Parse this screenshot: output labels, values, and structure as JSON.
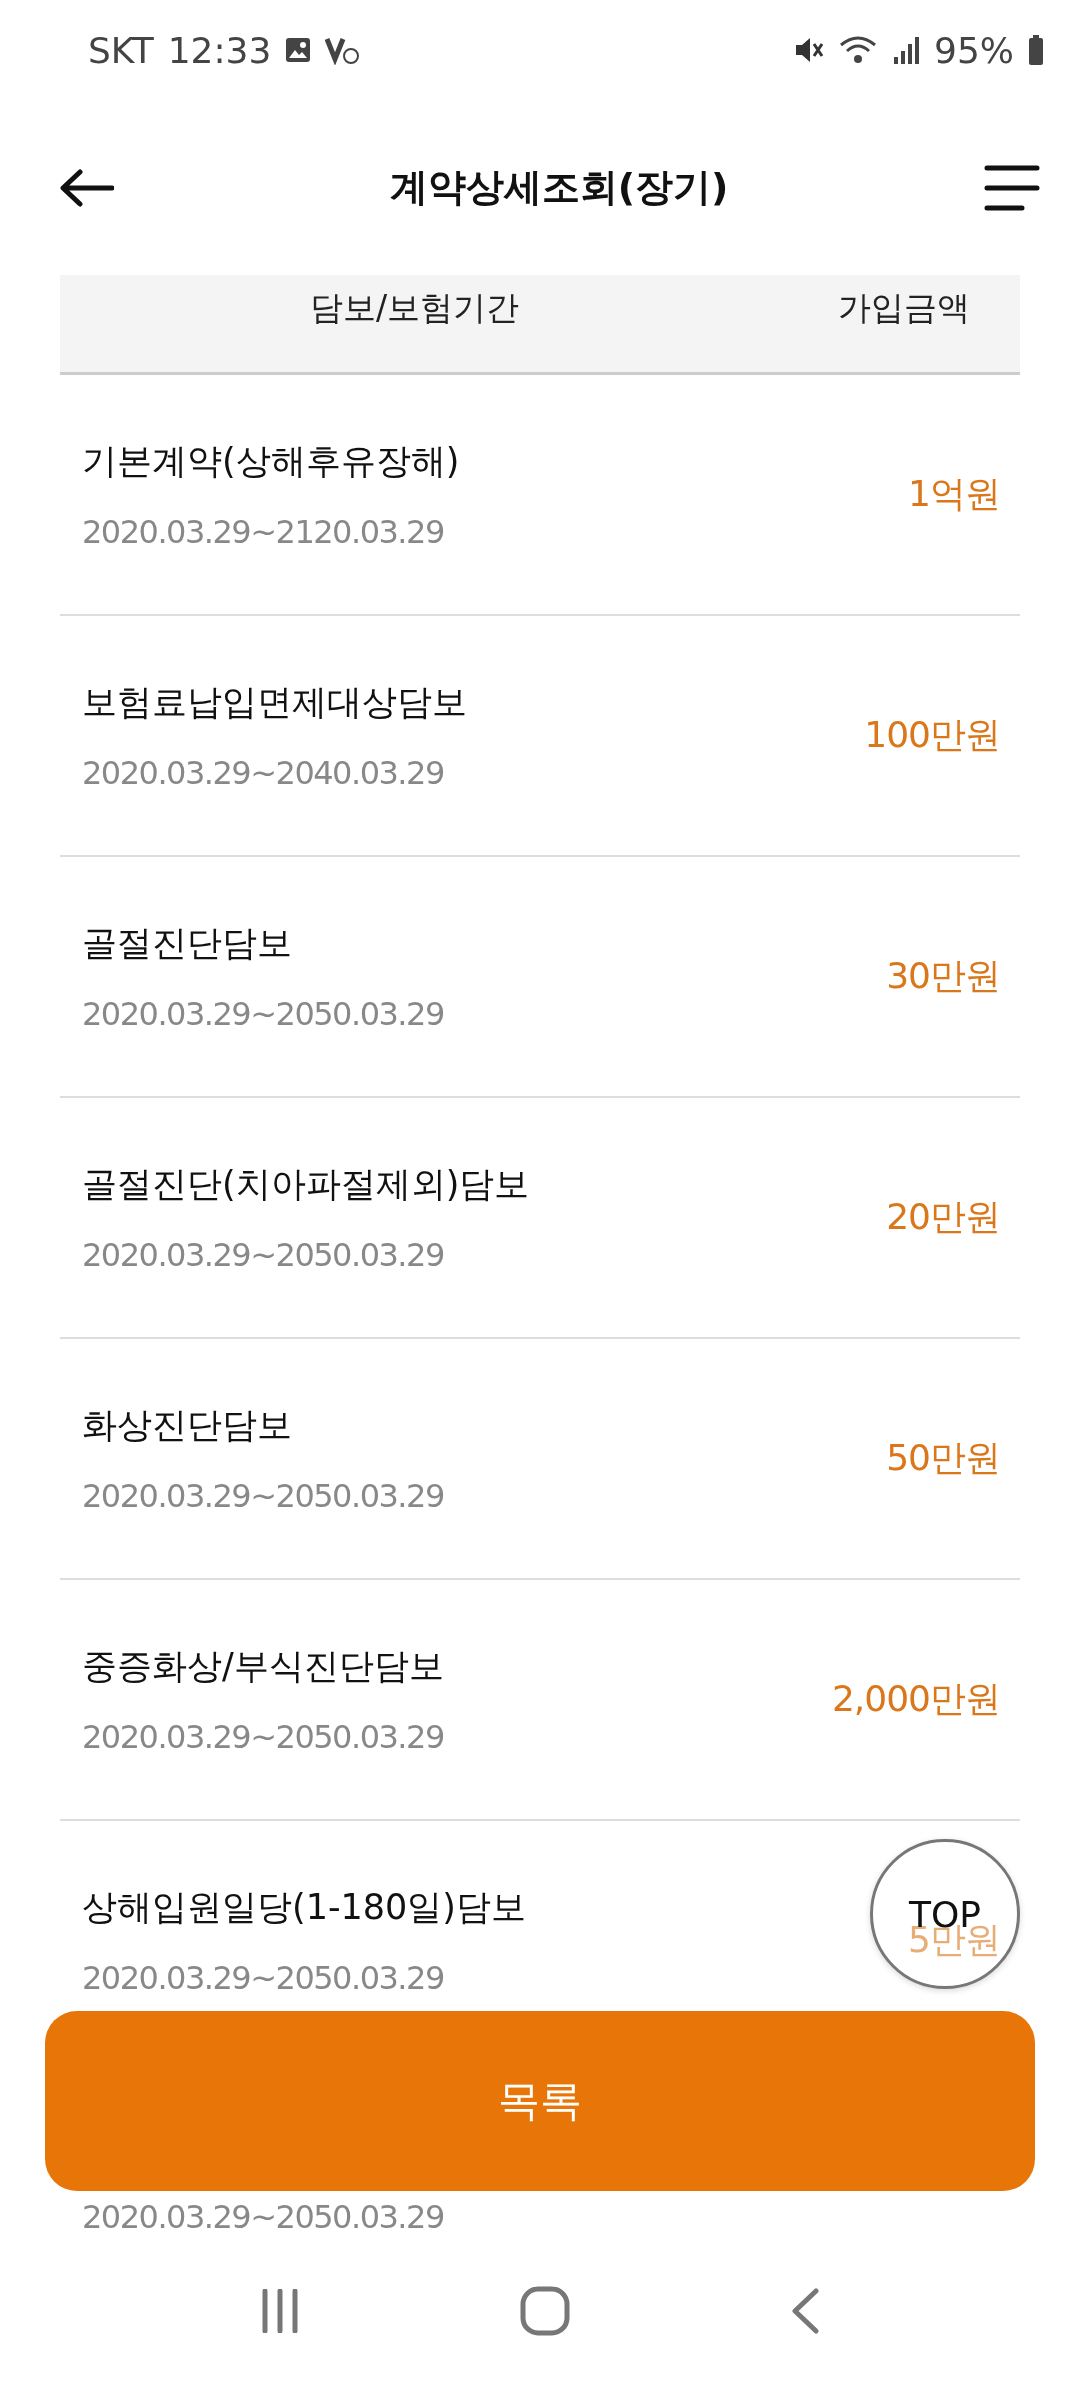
{
  "status_bar": {
    "carrier": "SKT",
    "time": "12:33",
    "battery": "95%"
  },
  "header": {
    "title": "계약상세조회(장기)"
  },
  "table": {
    "columns": [
      "담보/보험기간",
      "가입금액"
    ],
    "rows": [
      {
        "name": "기본계약(상해후유장해)",
        "period": "2020.03.29~2120.03.29",
        "amount": "1억원"
      },
      {
        "name": "보험료납입면제대상담보",
        "period": "2020.03.29~2040.03.29",
        "amount": "100만원"
      },
      {
        "name": "골절진단담보",
        "period": "2020.03.29~2050.03.29",
        "amount": "30만원"
      },
      {
        "name": "골절진단(치아파절제외)담보",
        "period": "2020.03.29~2050.03.29",
        "amount": "20만원"
      },
      {
        "name": "화상진단담보",
        "period": "2020.03.29~2050.03.29",
        "amount": "50만원"
      },
      {
        "name": "중증화상/부식진단담보",
        "period": "2020.03.29~2050.03.29",
        "amount": "2,000만원"
      },
      {
        "name": "상해입원일당(1-180일)담보",
        "period": "2020.03.29~2050.03.29",
        "amount": "5만원"
      },
      {
        "period": "2020.03.29~2050.03.29"
      }
    ]
  },
  "top_button": "TOP",
  "list_button": "목록"
}
